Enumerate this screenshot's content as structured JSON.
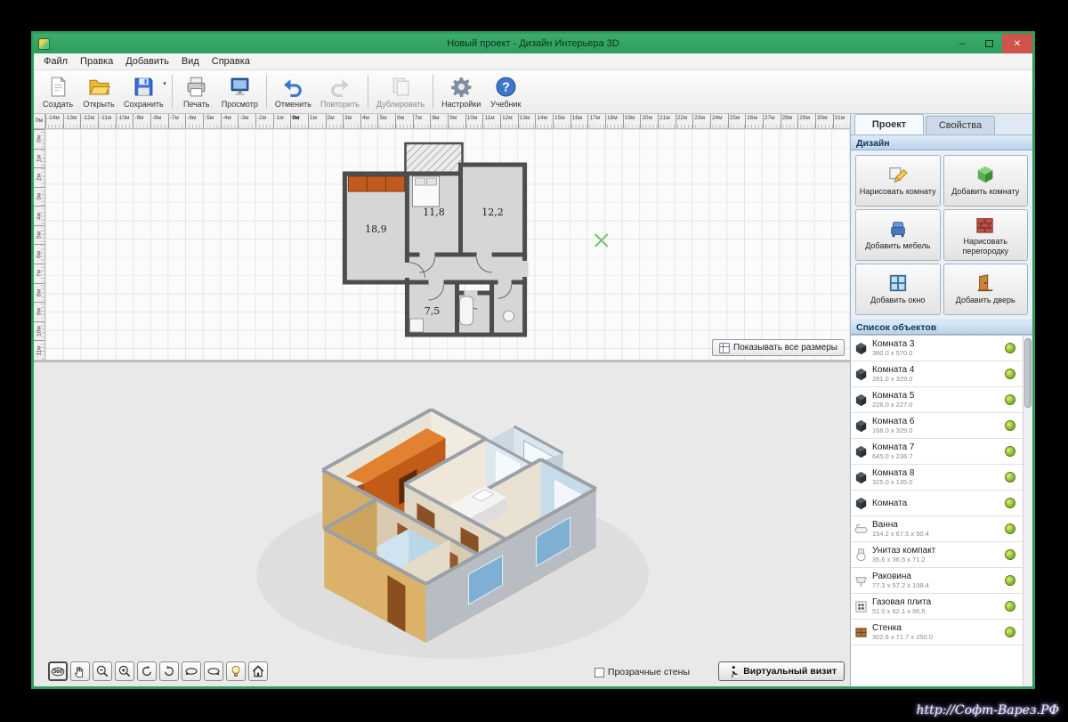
{
  "window": {
    "title": "Новый проект - Дизайн Интерьера 3D"
  },
  "menu": {
    "items": [
      "Файл",
      "Правка",
      "Добавить",
      "Вид",
      "Справка"
    ]
  },
  "toolbar": {
    "items": [
      {
        "label": "Создать",
        "icon": "new-doc-icon"
      },
      {
        "label": "Открыть",
        "icon": "open-folder-icon"
      },
      {
        "label": "Сохранить",
        "icon": "save-icon",
        "dropdown": true,
        "group_end": true
      },
      {
        "label": "Печать",
        "icon": "print-icon"
      },
      {
        "label": "Просмотр",
        "icon": "preview-icon",
        "group_end": true
      },
      {
        "label": "Отменить",
        "icon": "undo-icon"
      },
      {
        "label": "Повторить",
        "icon": "redo-icon",
        "disabled": true,
        "group_end": true
      },
      {
        "label": "Дублировать",
        "icon": "duplicate-icon",
        "disabled": true,
        "group_end": true
      },
      {
        "label": "Настройки",
        "icon": "settings-icon"
      },
      {
        "label": "Учебник",
        "icon": "help-icon"
      }
    ]
  },
  "rulers": {
    "corner": "0м",
    "top": [
      "-14м",
      "-13м",
      "-12м",
      "-11м",
      "-10м",
      "-9м",
      "-8м",
      "-7м",
      "-6м",
      "-5м",
      "-4м",
      "-3м",
      "-2м",
      "-1м",
      "0м",
      "1м",
      "2м",
      "3м",
      "4м",
      "5м",
      "6м",
      "7м",
      "8м",
      "9м",
      "10м",
      "11м",
      "12м",
      "13м",
      "14м",
      "15м",
      "16м",
      "17м",
      "18м",
      "19м",
      "20м",
      "21м",
      "22м",
      "23м",
      "24м",
      "25м",
      "26м",
      "27м",
      "28м",
      "29м",
      "30м",
      "31м"
    ],
    "left": [
      "0м",
      "1м",
      "2м",
      "3м",
      "4м",
      "5м",
      "6м",
      "7м",
      "8м",
      "9м",
      "10м",
      "11м"
    ]
  },
  "plan2d": {
    "room_labels": [
      "18,9",
      "11,8",
      "12,2",
      "7,5"
    ],
    "show_all_sizes": "Показывать все размеры"
  },
  "view3d": {
    "transparent_walls": "Прозрачные стены",
    "virtual_visit": "Виртуальный визит",
    "nav_buttons": [
      {
        "icon": "view-360-icon",
        "label": "360"
      },
      {
        "icon": "pan-hand-icon"
      },
      {
        "icon": "zoom-out-icon"
      },
      {
        "icon": "zoom-in-icon"
      },
      {
        "icon": "rotate-ccw-icon"
      },
      {
        "icon": "rotate-cw-icon"
      },
      {
        "icon": "orbit-left-icon"
      },
      {
        "icon": "orbit-right-icon"
      },
      {
        "icon": "light-icon"
      },
      {
        "icon": "home-icon"
      }
    ]
  },
  "right_panel": {
    "tabs": [
      {
        "label": "Проект",
        "active": true
      },
      {
        "label": "Свойства",
        "active": false
      }
    ],
    "design": {
      "title": "Дизайн",
      "buttons": [
        {
          "label": "Нарисовать комнату",
          "icon": "draw-room-icon"
        },
        {
          "label": "Добавить комнату",
          "icon": "add-room-icon"
        },
        {
          "label": "Добавить мебель",
          "icon": "add-furniture-icon"
        },
        {
          "label": "Нарисовать перегородку",
          "icon": "draw-wall-icon"
        },
        {
          "label": "Добавить окно",
          "icon": "add-window-icon"
        },
        {
          "label": "Добавить дверь",
          "icon": "add-door-icon"
        }
      ]
    },
    "objects": {
      "title": "Список объектов",
      "items": [
        {
          "name": "Комната 3",
          "size": "380.0 x 570.0",
          "icon": "room-icon"
        },
        {
          "name": "Комната 4",
          "size": "281.0 x 329.0",
          "icon": "room-icon"
        },
        {
          "name": "Комната 5",
          "size": "226.0 x 227.0",
          "icon": "room-icon"
        },
        {
          "name": "Комната 6",
          "size": "168.0 x 329.0",
          "icon": "room-icon"
        },
        {
          "name": "Комната 7",
          "size": "645.0 x 236.7",
          "icon": "room-icon"
        },
        {
          "name": "Комната 8",
          "size": "325.0 x 135.0",
          "icon": "room-icon"
        },
        {
          "name": "Комната",
          "size": "",
          "icon": "room-icon"
        },
        {
          "name": "Ванна",
          "size": "154.2 x 67.5 x 50.4",
          "icon": "bath-icon"
        },
        {
          "name": "Унитаз компакт",
          "size": "35.6 x 36.5 x 71.2",
          "icon": "toilet-icon"
        },
        {
          "name": "Раковина",
          "size": "77.3 x 57.2 x 108.4",
          "icon": "sink-icon"
        },
        {
          "name": "Газовая плита",
          "size": "51.0 x 62.1 x 96.5",
          "icon": "stove-icon"
        },
        {
          "name": "Стенка",
          "size": "302.6 x 71.7 x 250.0",
          "icon": "cabinet-icon"
        }
      ]
    }
  },
  "watermark": "http://Софт-Варез.РФ",
  "colors": {
    "accent_green": "#2e9e5f",
    "close_red": "#d0544a",
    "header_blue": "#b9d2e9",
    "eye_green": "#8ab82e"
  }
}
